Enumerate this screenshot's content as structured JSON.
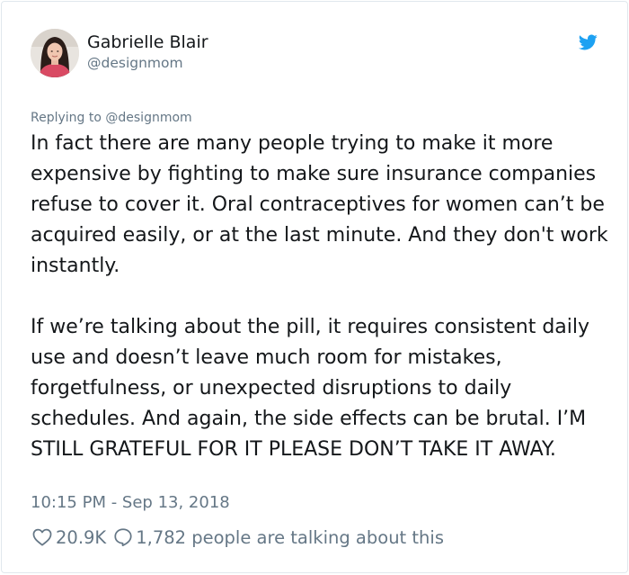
{
  "author": {
    "display_name": "Gabrielle Blair",
    "handle": "@designmom",
    "avatar_icon": "profile-photo"
  },
  "brand": {
    "icon": "twitter-bird-icon",
    "accent_color": "#1da1f2"
  },
  "reply_context": {
    "prefix": "Replying to",
    "mention": "@designmom"
  },
  "tweet": {
    "text": "In fact there are many people trying to make it more expensive by fighting to make sure insurance companies refuse to cover it. Oral contraceptives for women can’t be acquired easily, or at the last minute. And they don't work instantly.\n\nIf we’re talking about the pill, it requires consistent daily use and doesn’t leave much room for mistakes, forgetfulness, or unexpected disruptions to daily schedules. And again, the side effects can be brutal. I’M STILL GRATEFUL FOR IT PLEASE DON’T TAKE IT AWAY.",
    "timestamp": "10:15 PM - Sep 13, 2018"
  },
  "actions": {
    "likes": "20.9K",
    "talking": "1,782 people are talking about this",
    "like_icon": "heart-icon",
    "reply_icon": "speech-bubble-icon"
  },
  "colors": {
    "text_primary": "#14171a",
    "text_secondary": "#657786",
    "border": "#e1e8ed"
  }
}
